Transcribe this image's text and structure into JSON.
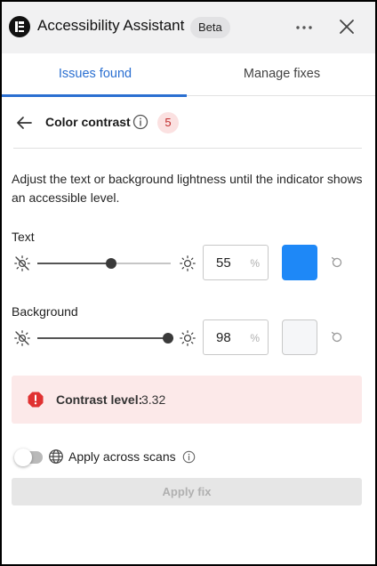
{
  "header": {
    "title": "Accessibility Assistant",
    "badge": "Beta",
    "logo_icon": "elementor-logo-icon",
    "more_icon": "more-horizontal-icon",
    "close_icon": "close-icon"
  },
  "tabs": [
    {
      "label": "Issues found",
      "active": true
    },
    {
      "label": "Manage fixes",
      "active": false
    }
  ],
  "issue": {
    "title": "Color contrast",
    "count": "5",
    "back_icon": "arrow-left-icon",
    "info_icon": "info-icon"
  },
  "description": "Adjust the text or background lightness until the indicator shows an accessible level.",
  "controls": {
    "text": {
      "label": "Text",
      "value": "55",
      "unit": "%",
      "level": 0.55,
      "color": "#1e88f7"
    },
    "background": {
      "label": "Background",
      "value": "98",
      "unit": "%",
      "level": 0.98,
      "color": "#f5f6f8"
    },
    "icons": {
      "dark": "brightness-low-icon",
      "light": "brightness-high-icon",
      "reset": "reset-icon"
    }
  },
  "contrast": {
    "label": "Contrast level:",
    "value": "3.32",
    "status_color": "#e03131",
    "icon": "alert-octagon-icon"
  },
  "apply_across": {
    "label": "Apply across scans",
    "enabled": false
  },
  "apply_button": {
    "label": "Apply fix",
    "disabled": true
  },
  "colors": {
    "accent": "#2a6fd1",
    "alert_bg": "#fce9e9",
    "badge_bg": "#fbe1e1",
    "badge_text": "#c02a2a"
  }
}
